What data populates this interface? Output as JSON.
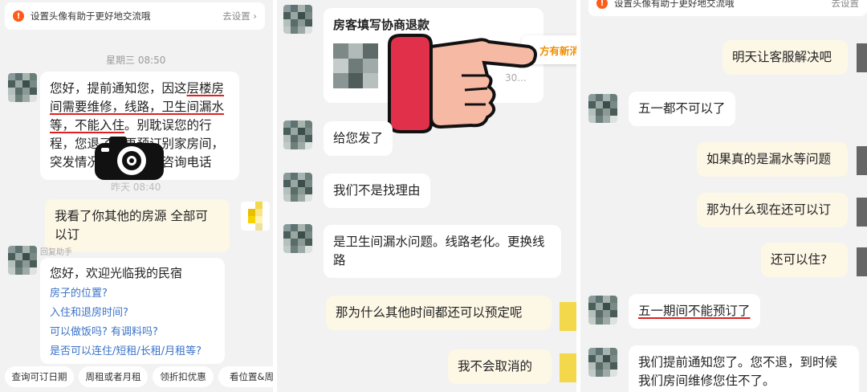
{
  "panel1": {
    "notice": {
      "text": "设置头像有助于更好地交流哦",
      "action": "去设置 ›"
    },
    "timestamp": "星期三 08:50",
    "message1": {
      "seg1": "您好，提前通知您，因这",
      "seg2": "层楼房间需要维修，线路，卫生间漏水等，不能入住",
      "seg3": "。别耽误您的行程，您退了，再预订别家房间，突发情况，互理解。咨询电话"
    },
    "timestamp_partial": "昨天 08:40",
    "message2": "我看了你其他的房源 全部可以订",
    "assistant_label": "回复助手",
    "assistant": {
      "greeting": "您好，欢迎光临我的民宿",
      "links": [
        "房子的位置?",
        "入住和退房时间?",
        "可以做饭吗? 有调料吗?",
        "是否可以连住/短租/长租/月租等?"
      ]
    },
    "chips": [
      "查询可订日期",
      "周租或者月租",
      "领折扣优惠",
      "看位置&周边"
    ]
  },
  "panel2": {
    "card_title": "房客填写协商退款",
    "card_sub": "30...",
    "overlay_text": "方有新消",
    "messages": [
      "给您发了",
      "我们不是找理由",
      "是卫生间漏水问题。线路老化。更换线路",
      "那为什么其他时间都还可以预定呢",
      "我不会取消的"
    ]
  },
  "panel3": {
    "notice": {
      "text": "设置头像有助于更好地交流哦",
      "action": "去设置"
    },
    "messages": [
      "明天让客服解决吧",
      "五一都不可以了",
      "如果真的是漏水等问题",
      "那为什么现在还可以订",
      "还可以住?",
      "五一期间不能预订了",
      "我们提前通知您了。您不退，到时候我们房间维修您住不了。"
    ]
  },
  "colors": {
    "accent": "#e02020",
    "link": "#3b73c9",
    "bubble_right": "#fdf7e6",
    "warning": "#ff5c1a"
  },
  "icons": [
    "warning-icon",
    "camera-icon",
    "pointing-hand-icon",
    "chevron-right-icon"
  ]
}
